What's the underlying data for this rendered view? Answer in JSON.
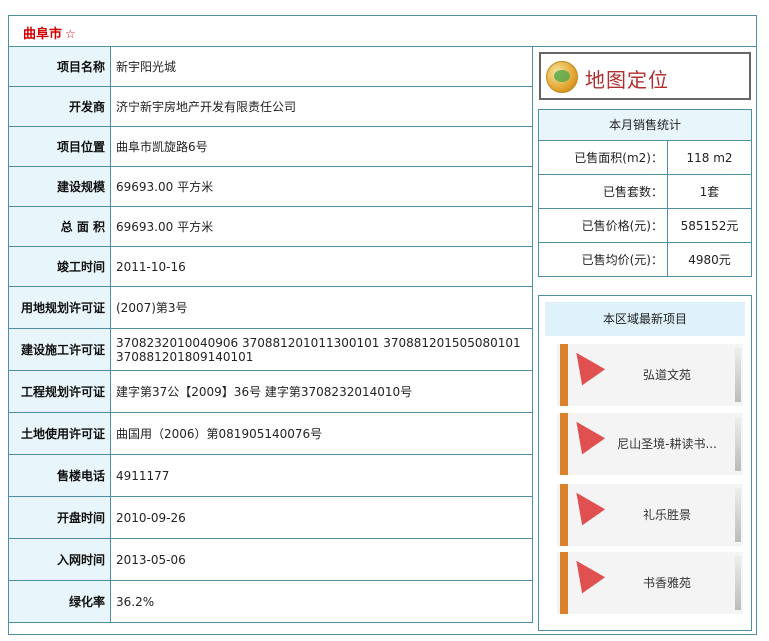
{
  "header": {
    "city": "曲阜市",
    "star": "☆"
  },
  "info_rows": [
    {
      "label": "项目名称",
      "value": "新宇阳光城"
    },
    {
      "label": "开发商",
      "value": "济宁新宇房地产开发有限责任公司"
    },
    {
      "label": "项目位置",
      "value": "曲阜市凯旋路6号"
    },
    {
      "label": "建设规模",
      "value": "69693.00 平方米"
    },
    {
      "label": "总 面 积",
      "value": "69693.00 平方米"
    },
    {
      "label": "竣工时间",
      "value": "2011-10-16"
    },
    {
      "label": "用地规划许可证",
      "value": "(2007)第3号"
    },
    {
      "label": "建设施工许可证",
      "value": "370823201004090 6 370881201011300101 370881201505080101 370881201809140101"
    },
    {
      "label": "工程规划许可证",
      "value": "建字第37公【2009】36号 建字第3708232014010号"
    },
    {
      "label": "土地使用许可证",
      "value": "曲国用（2006）第081905140076号"
    },
    {
      "label": "售楼电话",
      "value": "4911177"
    },
    {
      "label": "开盘时间",
      "value": "2010-09-26"
    },
    {
      "label": "入网时间",
      "value": "2013-05-06"
    },
    {
      "label": "绿化率",
      "value": "36.2%"
    }
  ],
  "map_button": {
    "label": "地图定位",
    "icon": "globe-icon"
  },
  "sales_stats": {
    "title": "本月销售统计",
    "rows": [
      {
        "key": "已售面积(m2)：",
        "value": "118 m2"
      },
      {
        "key": "已售套数：",
        "value": "1套"
      },
      {
        "key": "已售价格(元)：",
        "value": "585152元"
      },
      {
        "key": "已售均价(元)：",
        "value": "4980元"
      }
    ]
  },
  "area_projects": {
    "title": "本区域最新项目",
    "items": [
      "弘道文苑",
      "尼山圣境-耕读书...",
      "礼乐胜景",
      "书香雅苑"
    ]
  }
}
